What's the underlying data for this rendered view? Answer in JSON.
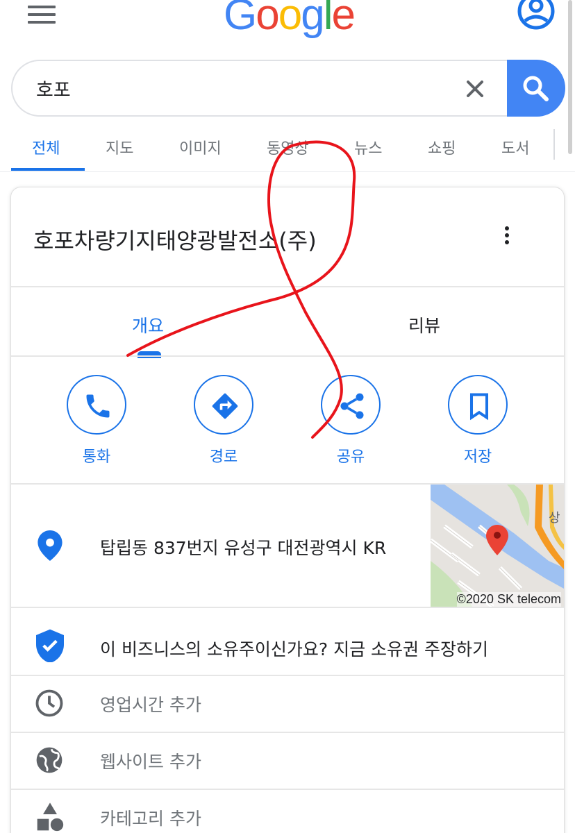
{
  "header": {
    "logo_letters": [
      "G",
      "o",
      "o",
      "g",
      "l",
      "e"
    ],
    "logo_colors": [
      "#4285f4",
      "#ea4335",
      "#fbbc05",
      "#4285f4",
      "#34a853",
      "#ea4335"
    ]
  },
  "search": {
    "value": "호포"
  },
  "tabs": [
    {
      "label": "전체",
      "active": true
    },
    {
      "label": "지도"
    },
    {
      "label": "이미지"
    },
    {
      "label": "동영상"
    },
    {
      "label": "뉴스"
    },
    {
      "label": "쇼핑"
    },
    {
      "label": "도서"
    }
  ],
  "place": {
    "title": "호포차량기지태양광발전소(주)",
    "subtabs": [
      {
        "label": "개요",
        "active": true
      },
      {
        "label": "리뷰"
      }
    ],
    "actions": [
      {
        "label": "통화",
        "icon": "phone-icon"
      },
      {
        "label": "경로",
        "icon": "directions-icon"
      },
      {
        "label": "공유",
        "icon": "share-icon"
      },
      {
        "label": "저장",
        "icon": "bookmark-icon"
      }
    ],
    "address": "탑립동 837번지 유성구 대전광역시 KR",
    "map_credit": "©2020 SK telecom",
    "map_label": "상",
    "claim": "이 비즈니스의 소유주이신가요? 지금 소유권 주장하기",
    "add_hours": "영업시간 추가",
    "add_website": "웹사이트 추가",
    "add_category": "카테고리 추가"
  },
  "colors": {
    "accent": "#1a73e8",
    "search_button": "#4285f4",
    "annotation": "#e8141b"
  }
}
